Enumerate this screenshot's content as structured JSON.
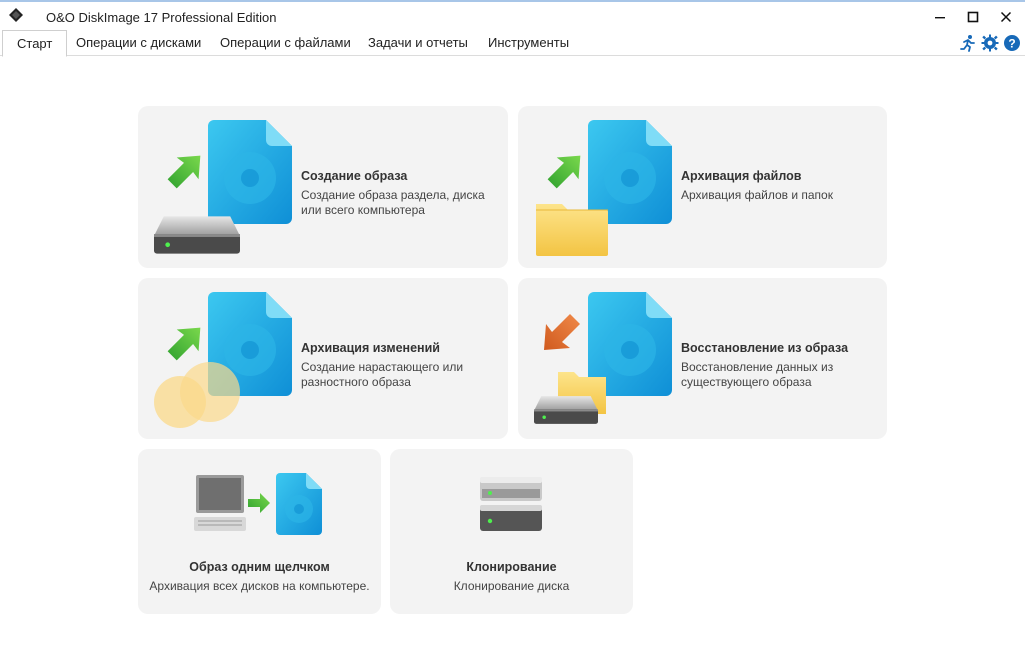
{
  "window": {
    "title": "O&O DiskImage 17 Professional Edition",
    "controls": {
      "minimize": "—",
      "maximize": "□",
      "close": "✕"
    }
  },
  "tabs": [
    {
      "label": "Старт",
      "active": true
    },
    {
      "label": "Операции с дисками",
      "active": false
    },
    {
      "label": "Операции с файлами",
      "active": false
    },
    {
      "label": "Задачи и отчеты",
      "active": false
    },
    {
      "label": "Инструменты",
      "active": false
    }
  ],
  "toolbar_icons": [
    "run-icon",
    "settings-gear-icon",
    "help-icon"
  ],
  "cards": [
    {
      "title": "Создание образа",
      "desc_line1": "Создание образа раздела, диска",
      "desc_line2": "или всего компьютера",
      "icon": "drive-image-icon"
    },
    {
      "title": "Архивация файлов",
      "desc_line1": "Архивация файлов и папок",
      "icon": "file-backup-icon"
    },
    {
      "title": "Архивация изменений",
      "desc_line1": "Создание нарастающего или",
      "desc_line2": "разностного образа",
      "icon": "incremental-backup-icon"
    },
    {
      "title": "Восстановление из образа",
      "desc_line1": "Восстановление данных из",
      "desc_line2": "существующего образа",
      "icon": "restore-icon"
    },
    {
      "title": "Образ одним щелчком",
      "desc_line1": "Архивация всех дисков на компьютере.",
      "icon": "one-click-image-icon"
    },
    {
      "title": "Клонирование",
      "desc_line1": "Клонирование диска",
      "icon": "clone-drive-icon"
    }
  ],
  "colors": {
    "card_bg": "#f3f3f3",
    "arrow_green": "#3cb83c",
    "arrow_orange": "#e06a2a",
    "file_blue": "#1ea7e0",
    "folder_yellow": "#f6cf55"
  }
}
